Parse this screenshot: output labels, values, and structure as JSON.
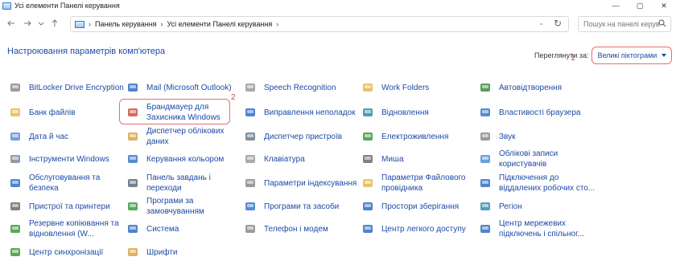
{
  "window": {
    "title": "Усі елементи Панелі керування",
    "controls": [
      "—",
      "▢",
      "✕"
    ]
  },
  "address": {
    "crumbs": [
      "Панель керування",
      "Усі елементи Панелі керування"
    ],
    "search_placeholder": "Пошук на панелі керування"
  },
  "header": {
    "title": "Настроювання параметрів комп'ютера",
    "view_by_label": "Переглянути за:",
    "view_by_value": "Великі піктограми"
  },
  "annotations": [
    "1",
    "2"
  ],
  "items": [
    {
      "label": "BitLocker Drive Encryption",
      "icon": "bitlocker-icon",
      "color": "#8a8a8a"
    },
    {
      "label": "Mail (Microsoft Outlook)",
      "icon": "mail-icon",
      "color": "#2f6fc6"
    },
    {
      "label": "Speech Recognition",
      "icon": "microphone-icon",
      "color": "#9a9a9a"
    },
    {
      "label": "Work Folders",
      "icon": "folder-icon",
      "color": "#e8b84a"
    },
    {
      "label": "Автовідтворення",
      "icon": "autoplay-icon",
      "color": "#3c8c3c"
    },
    {
      "label": "Банк файлів",
      "icon": "file-history-icon",
      "color": "#e8b84a"
    },
    {
      "label": "Брандмауер для Захисника Windows",
      "icon": "firewall-icon",
      "color": "#c8553d"
    },
    {
      "label": "Виправлення неполадок",
      "icon": "troubleshoot-icon",
      "color": "#2f6fc6"
    },
    {
      "label": "Відновлення",
      "icon": "recovery-icon",
      "color": "#2f8fb0"
    },
    {
      "label": "Властивості браузера",
      "icon": "internet-options-icon",
      "color": "#3a78c9"
    },
    {
      "label": "Дата й час",
      "icon": "clock-icon",
      "color": "#5a8fd6"
    },
    {
      "label": "Диспетчер облікових даних",
      "icon": "credential-manager-icon",
      "color": "#d9a441"
    },
    {
      "label": "Диспетчер пристроїв",
      "icon": "device-manager-icon",
      "color": "#6b7b8c"
    },
    {
      "label": "Електроживлення",
      "icon": "power-icon",
      "color": "#3c9a3c"
    },
    {
      "label": "Звук",
      "icon": "speaker-icon",
      "color": "#8a8a8a"
    },
    {
      "label": "Інструменти Windows",
      "icon": "tools-icon",
      "color": "#7a8a9a"
    },
    {
      "label": "Керування кольором",
      "icon": "color-management-icon",
      "color": "#3a78c9"
    },
    {
      "label": "Клавіатура",
      "icon": "keyboard-icon",
      "color": "#9a9a9a"
    },
    {
      "label": "Миша",
      "icon": "mouse-icon",
      "color": "#6a6a6a"
    },
    {
      "label": "Облікові записи користувачів",
      "icon": "users-icon",
      "color": "#4a90d9"
    },
    {
      "label": "Обслуговування та безпека",
      "icon": "flag-icon",
      "color": "#2f6fc6"
    },
    {
      "label": "Панель завдань і переходи",
      "icon": "taskbar-icon",
      "color": "#5a6a7a"
    },
    {
      "label": "Параметри індексування",
      "icon": "indexing-icon",
      "color": "#8a8a8a"
    },
    {
      "label": "Параметри Файлового провідника",
      "icon": "folder-options-icon",
      "color": "#e8b84a"
    },
    {
      "label": "Підключення до віддалених робочих сто...",
      "icon": "remote-desktop-icon",
      "color": "#2f6fc6"
    },
    {
      "label": "Пристрої та принтери",
      "icon": "printer-icon",
      "color": "#6a6a6a"
    },
    {
      "label": "Програми за замовчуванням",
      "icon": "default-programs-icon",
      "color": "#3c9a3c"
    },
    {
      "label": "Програми та засоби",
      "icon": "programs-icon",
      "color": "#3a78c9"
    },
    {
      "label": "Простори зберігання",
      "icon": "storage-spaces-icon",
      "color": "#2f6fc6"
    },
    {
      "label": "Регіон",
      "icon": "globe-icon",
      "color": "#2f8fb0"
    },
    {
      "label": "Резервне копіювання та відновлення (W...",
      "icon": "backup-icon",
      "color": "#3c9a3c"
    },
    {
      "label": "Система",
      "icon": "system-icon",
      "color": "#2f6fc6"
    },
    {
      "label": "Телефон і модем",
      "icon": "phone-icon",
      "color": "#8a8a8a"
    },
    {
      "label": "Центр легкого доступу",
      "icon": "ease-of-access-icon",
      "color": "#2f6fc6"
    },
    {
      "label": "Центр мережевих підключень і спільног...",
      "icon": "network-icon",
      "color": "#2f6fc6"
    },
    {
      "label": "Центр синхронізації",
      "icon": "sync-icon",
      "color": "#3c9a3c"
    },
    {
      "label": "Шрифти",
      "icon": "fonts-icon",
      "color": "#d9a441"
    }
  ]
}
